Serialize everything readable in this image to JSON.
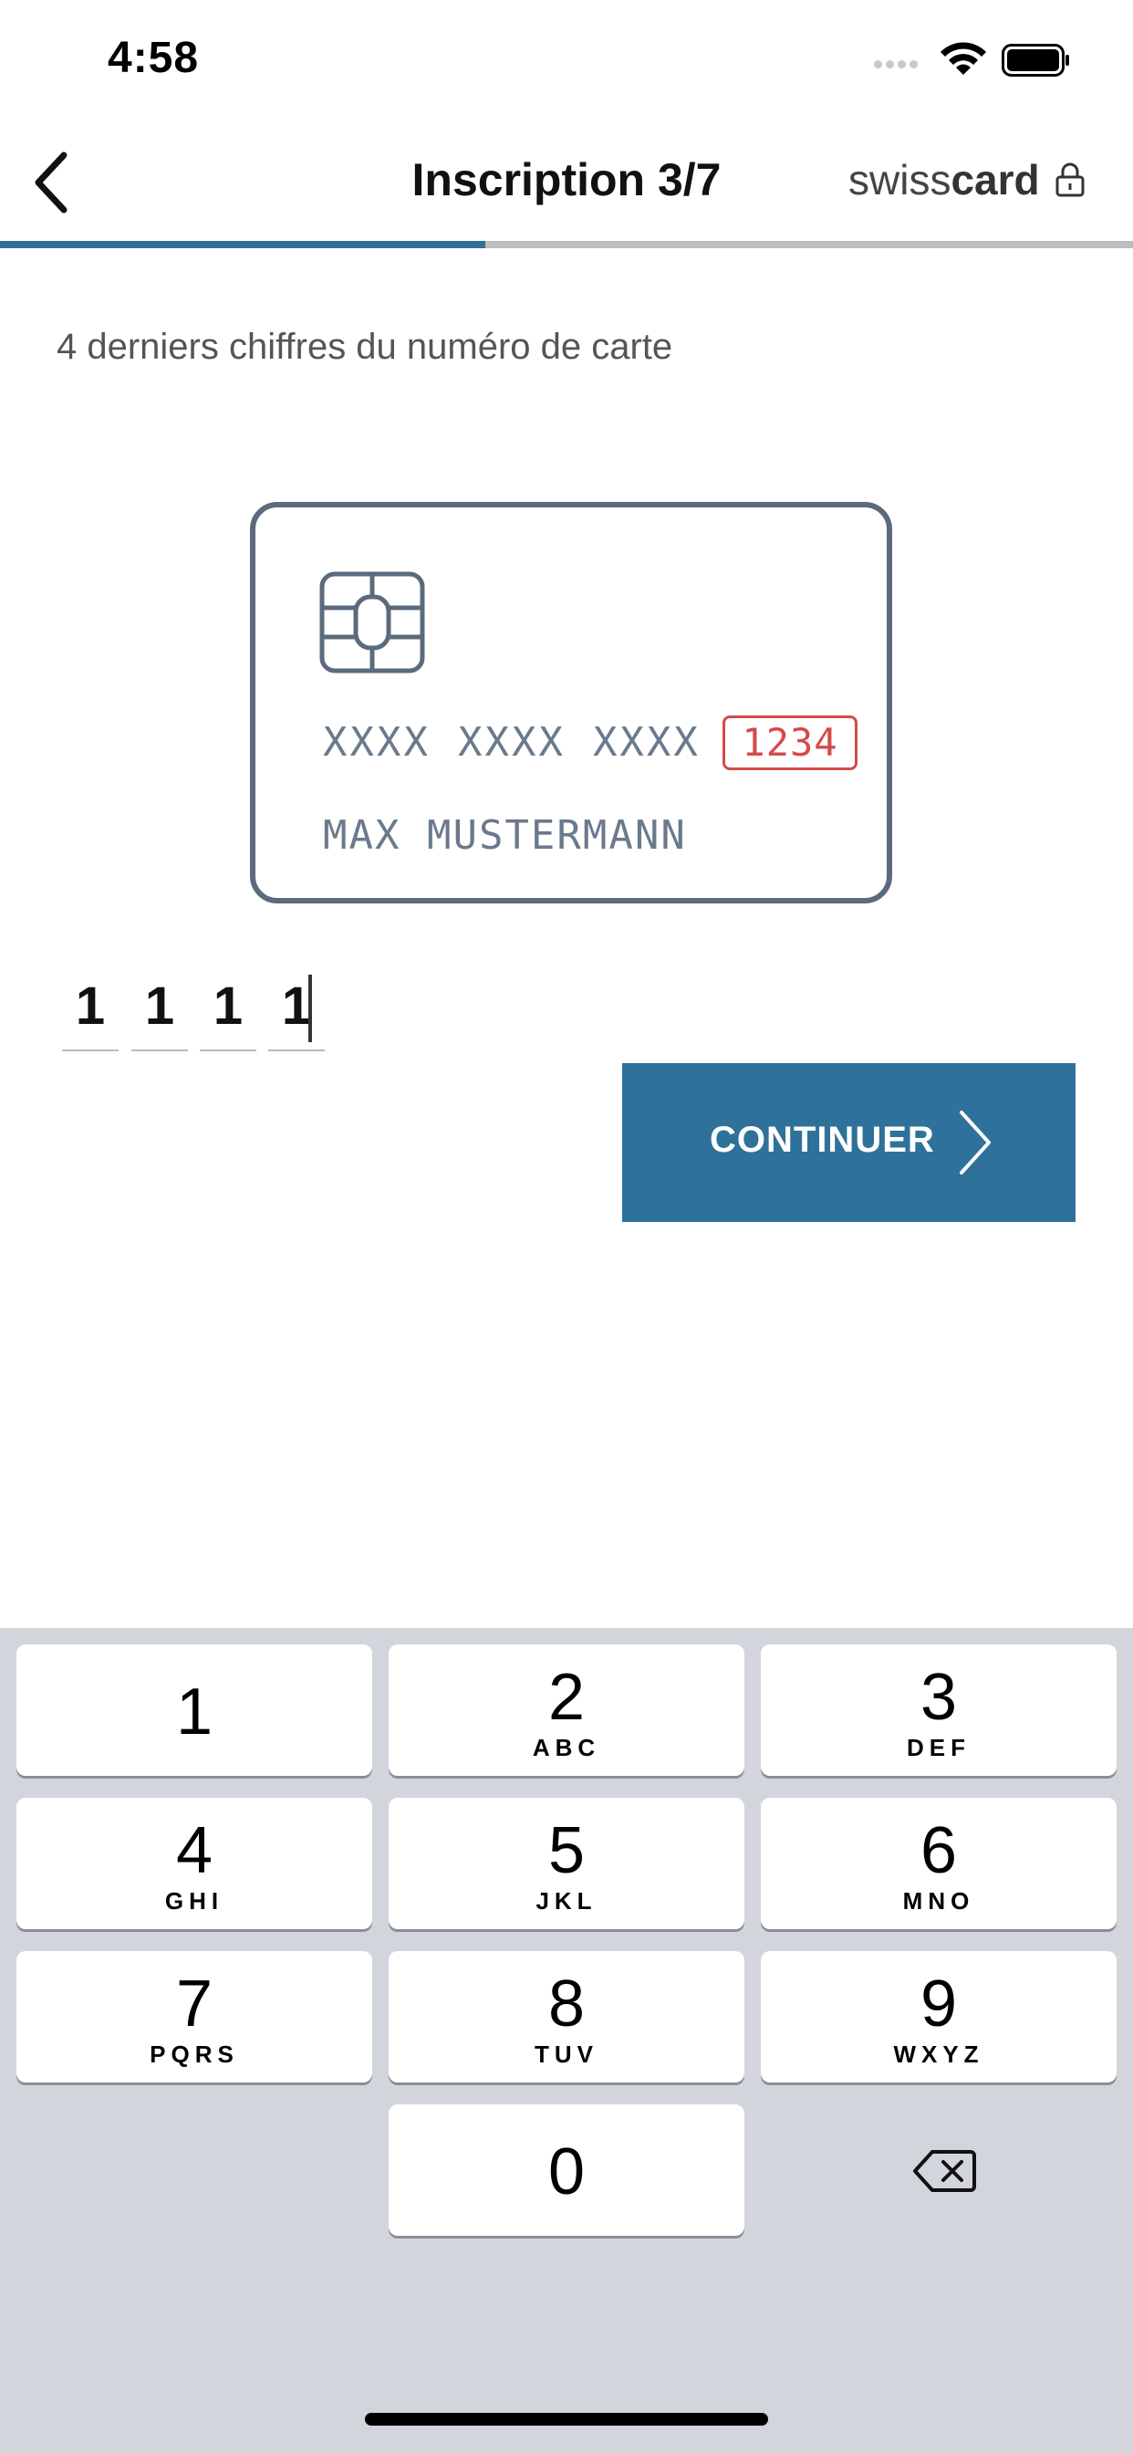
{
  "status_bar": {
    "time": "4:58"
  },
  "header": {
    "title": "Inscription 3/7",
    "brand_light": "swiss",
    "brand_bold": "card",
    "progress_fraction": 0.4286
  },
  "instruction": "4 derniers chiffres du numéro de carte",
  "card": {
    "number_groups": [
      "XXXX",
      "XXXX",
      "XXXX"
    ],
    "last_four": "1234",
    "holder": "MAX MUSTERMANN"
  },
  "pin": {
    "digits": [
      "1",
      "1",
      "1",
      "1"
    ]
  },
  "continue_button": {
    "label": "CONTINUER"
  },
  "keyboard": {
    "keys": [
      {
        "digit": "1",
        "letters": ""
      },
      {
        "digit": "2",
        "letters": "ABC"
      },
      {
        "digit": "3",
        "letters": "DEF"
      },
      {
        "digit": "4",
        "letters": "GHI"
      },
      {
        "digit": "5",
        "letters": "JKL"
      },
      {
        "digit": "6",
        "letters": "MNO"
      },
      {
        "digit": "7",
        "letters": "PQRS"
      },
      {
        "digit": "8",
        "letters": "TUV"
      },
      {
        "digit": "9",
        "letters": "WXYZ"
      },
      {
        "digit": "0",
        "letters": ""
      }
    ]
  },
  "colors": {
    "accent": "#2e729b",
    "progress_fill": "#2f6f98",
    "highlight_red": "#d44a4a",
    "card_border": "#5b6b7d",
    "keyboard_bg": "#d2d5db"
  }
}
